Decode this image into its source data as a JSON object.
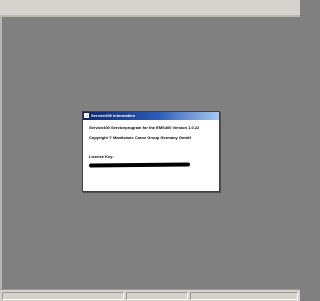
{
  "dialog": {
    "title": "Service400 information",
    "program_line": "Service400 Serviceprogram for the EMS400 Version 1.0.22",
    "copyright_line": "Copyright © Manitowoc Crane Group Germany GmbH",
    "license_label": "License Key:"
  }
}
